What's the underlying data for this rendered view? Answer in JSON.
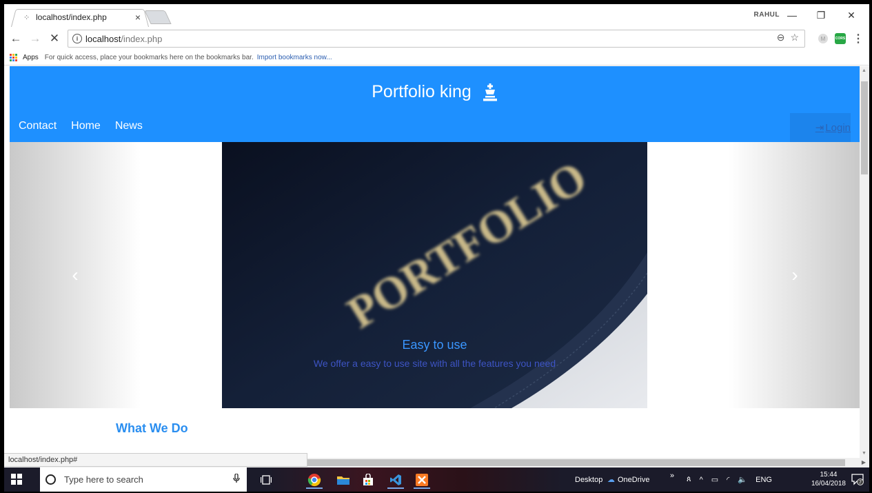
{
  "browser": {
    "tab_title": "localhost/index.php",
    "tab_close": "×",
    "profile_name": "RAHUL",
    "minimize": "—",
    "restore": "❐",
    "close": "✕",
    "back": "←",
    "forward": "→",
    "stop": "✕",
    "info": "i",
    "url_host": "localhost",
    "url_path": "/index.php",
    "zoom_icon": "⊖",
    "star_icon": "☆",
    "ext_m": "M",
    "ext_cors": "CORS",
    "menu": "⋮",
    "apps_colors": [
      "#e94235",
      "#fbbc04",
      "#34a853",
      "#4285f4",
      "#ea4335",
      "#fbbc04",
      "#34a853",
      "#4285f4",
      "#ea4335"
    ]
  },
  "bookmarks": {
    "apps_label": "Apps",
    "message": "For quick access, place your bookmarks here on the bookmarks bar.",
    "import_link": "Import bookmarks now..."
  },
  "site": {
    "brand": "Portfolio king",
    "nav": [
      "Contact",
      "Home",
      "News"
    ],
    "login": "Login",
    "login_icon": "⇥",
    "carousel": {
      "prev": "‹",
      "next": "›",
      "slide_word": "PORTFOLIO",
      "caption_title": "Easy to use",
      "caption_text": "We offer a easy to use site with all the features you need"
    },
    "section_title": "What We Do",
    "accent": "#1e90ff"
  },
  "status_bar": {
    "url": "localhost/index.php#"
  },
  "taskbar": {
    "search_placeholder": "Type here to search",
    "mic": "🎙",
    "desktop_label": "Desktop",
    "onedrive_label": "OneDrive",
    "overflow": "»",
    "lang": "ENG",
    "time": "15:44",
    "date": "16/04/2018",
    "notifications": "7"
  }
}
